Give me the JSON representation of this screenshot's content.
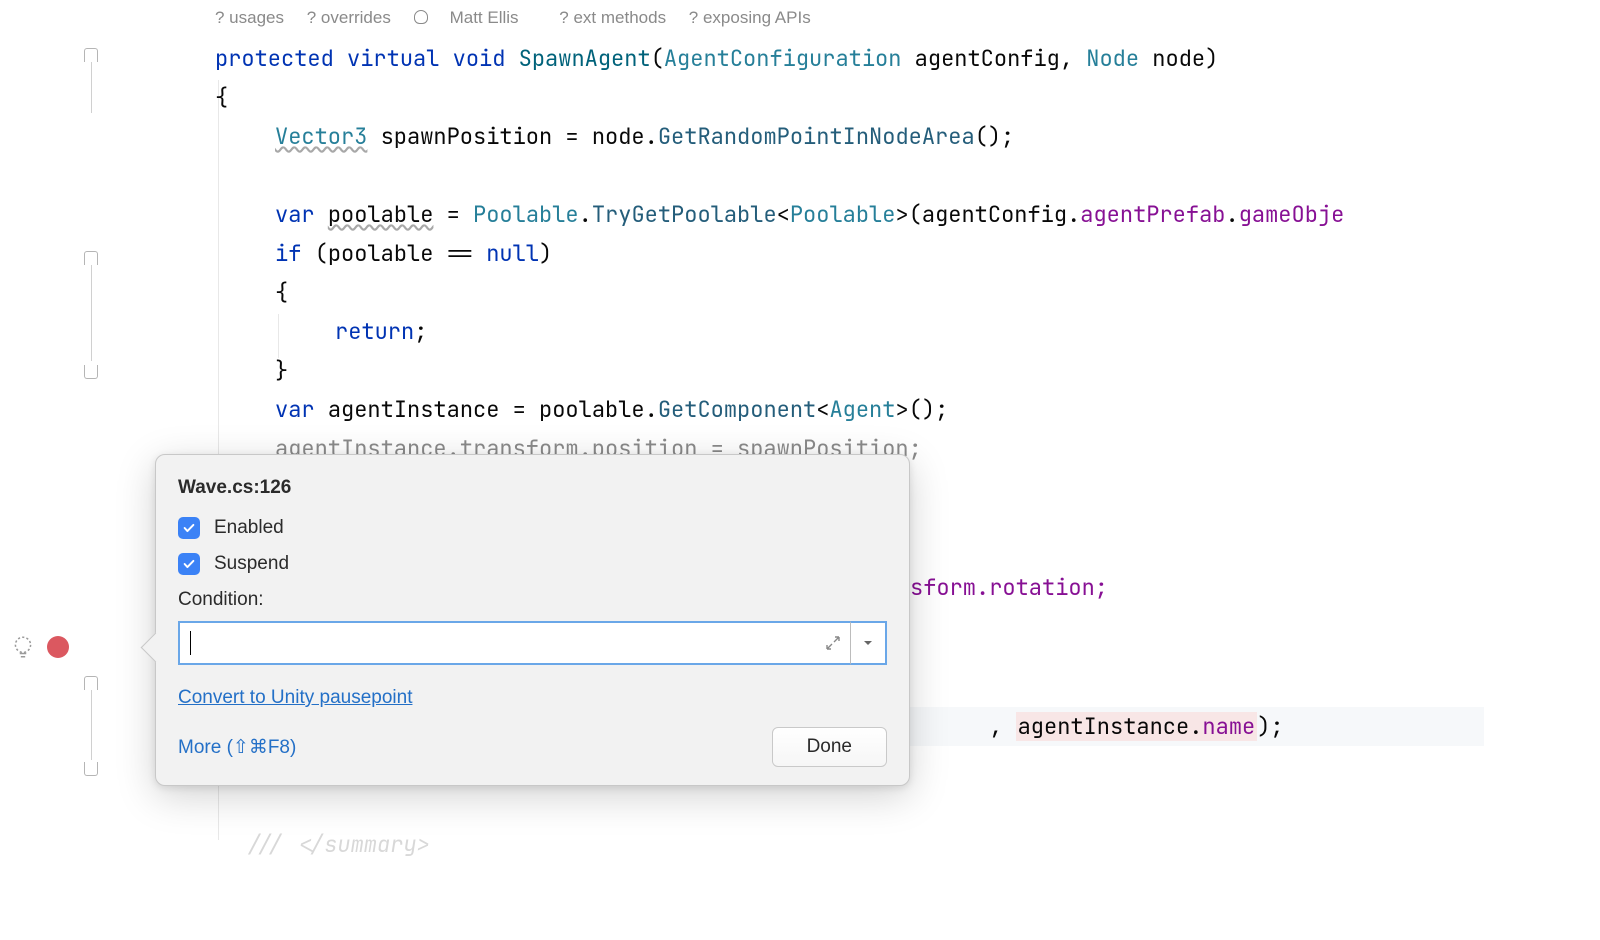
{
  "hints": {
    "usages": "? usages",
    "overrides": "? overrides",
    "author": "Matt Ellis",
    "ext_methods": "? ext methods",
    "exposing_apis": "? exposing APIs"
  },
  "code": {
    "l1_protected": "protected",
    "l1_virtual": "virtual",
    "l1_void": "void",
    "l1_method": "SpawnAgent",
    "l1_type1": "AgentConfiguration",
    "l1_param1": "agentConfig",
    "l1_type2": "Node",
    "l1_param2": "node",
    "l2_brace": "{",
    "l3_type": "Vector3",
    "l3_var": "spawnPosition",
    "l3_node": "node",
    "l3_call": "GetRandomPointInNodeArea",
    "l5_var": "var",
    "l5_poolable": "poolable",
    "l5_cls": "Poolable",
    "l5_method": "TryGetPoolable",
    "l5_tparam": "Poolable",
    "l5_ac": "agentConfig",
    "l5_prefab": "agentPrefab",
    "l5_go": "gameObje",
    "l6_if": "if",
    "l6_pool": "poolable",
    "l6_eq": "==",
    "l6_null": "null",
    "l7_brace": "{",
    "l8_return": "return",
    "l9_brace": "}",
    "l10_var": "var",
    "l10_ai": "agentInstance",
    "l10_pool": "poolable",
    "l10_gc": "GetComponent",
    "l10_agent": "Agent",
    "l11_pre": "agentInstance.transform.position = spawnPosition;",
    "l13_tail": "sform.rotation;",
    "l14_pre": ", ",
    "l14_ai": "agentInstance",
    "l14_name": "name",
    "l14_post": ");",
    "l15_brace": "}",
    "l16_comment": "/// </summary>"
  },
  "popup": {
    "title": "Wave.cs:126",
    "enabled_label": "Enabled",
    "suspend_label": "Suspend",
    "condition_label": "Condition:",
    "condition_value": "",
    "convert_link": "Convert to Unity pausepoint",
    "more_label": "More (⇧⌘F8)",
    "done_label": "Done"
  }
}
